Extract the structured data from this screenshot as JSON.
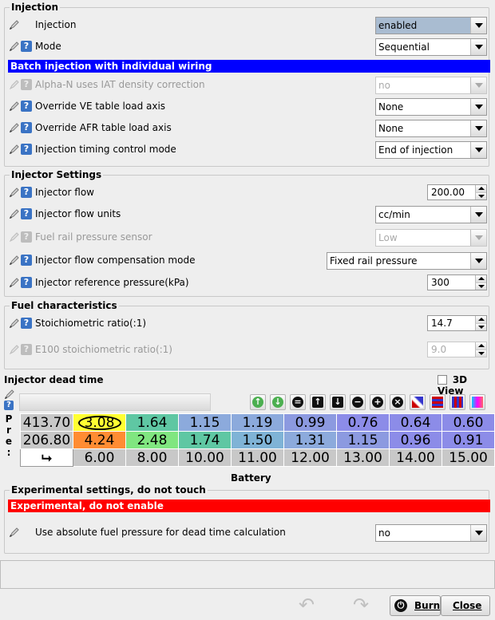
{
  "injection": {
    "title": "Injection",
    "injection_label": "Injection",
    "injection_value": "enabled",
    "mode_label": "Mode",
    "mode_value": "Sequential",
    "banner": "Batch injection with individual wiring",
    "banner_color": "#0000ff",
    "alphan_label": "Alpha-N uses IAT density correction",
    "alphan_value": "no",
    "ve_label": "Override VE table load axis",
    "ve_value": "None",
    "afr_label": "Override AFR table load axis",
    "afr_value": "None",
    "timing_label": "Injection timing control mode",
    "timing_value": "End of injection"
  },
  "injector_settings": {
    "title": "Injector Settings",
    "flow_label": "Injector flow",
    "flow_value": "200.00",
    "units_label": "Injector flow units",
    "units_value": "cc/min",
    "rail_label": "Fuel rail pressure sensor",
    "rail_value": "Low",
    "comp_label": "Injector flow compensation mode",
    "comp_value": "Fixed rail pressure",
    "ref_label": "Injector reference pressure(kPa)",
    "ref_value": "300"
  },
  "fuel": {
    "title": "Fuel characteristics",
    "stoich_label": "Stoichiometric ratio(:1)",
    "stoich_value": "14.7",
    "e100_label": "E100 stoichiometric ratio(:1)",
    "e100_value": "9.0"
  },
  "dead_time": {
    "title": "Injector dead time",
    "view3d_label": "3D View",
    "side_label": [
      "P",
      "r",
      "e",
      ":"
    ],
    "x_axis_label": "Battery",
    "row_headers": [
      "413.70",
      "206.80"
    ],
    "rows": [
      [
        "3.08",
        "1.64",
        "1.15",
        "1.19",
        "0.99",
        "0.76",
        "0.64",
        "0.60"
      ],
      [
        "4.24",
        "2.48",
        "1.74",
        "1.50",
        "1.31",
        "1.15",
        "0.96",
        "0.91"
      ]
    ],
    "col_headers": [
      "6.00",
      "8.00",
      "10.00",
      "11.00",
      "12.00",
      "13.00",
      "14.00",
      "15.00"
    ],
    "colors": [
      [
        "#ffff33",
        "#5fc7a3",
        "#8caadc",
        "#8caadc",
        "#8c9ae0",
        "#8c8ce8",
        "#8c8ce8",
        "#8c8ce8"
      ],
      [
        "#ff8c33",
        "#80e680",
        "#5fc7a3",
        "#7fb3d6",
        "#8caadc",
        "#8c9ae0",
        "#8c8ce8",
        "#8c8ce8"
      ]
    ]
  },
  "experimental": {
    "title": "Experimental settings, do not touch",
    "banner": "Experimental, do not enable",
    "banner_color": "#ff0000",
    "abs_label": "Use absolute fuel pressure for dead time calculation",
    "abs_value": "no"
  },
  "footer": {
    "burn_label": "Burn",
    "close_label": "Close"
  }
}
